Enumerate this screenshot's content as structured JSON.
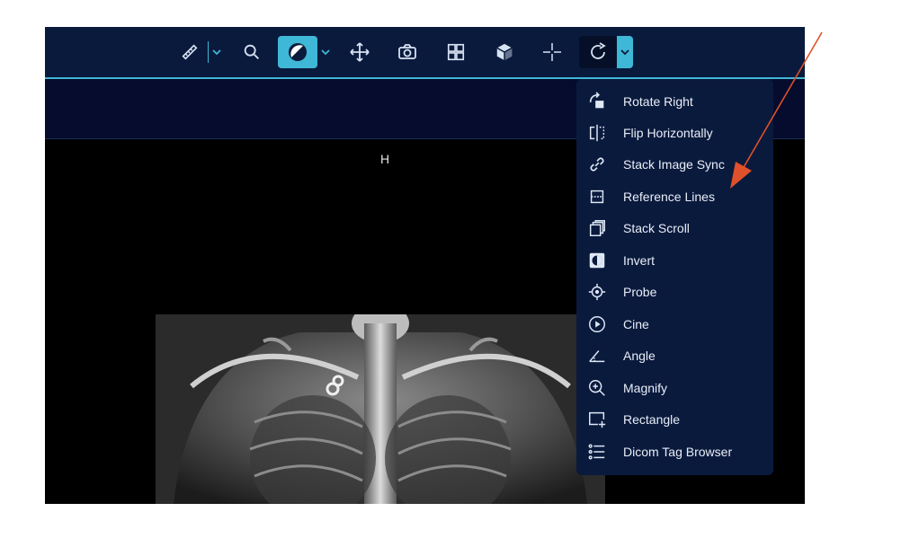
{
  "viewport": {
    "orientation_marker": "H"
  },
  "toolbar": {
    "tools": [
      {
        "id": "measure",
        "icon": "ruler-icon"
      },
      {
        "id": "zoom",
        "icon": "magnifier-icon"
      },
      {
        "id": "window-level",
        "icon": "contrast-icon",
        "active": true
      },
      {
        "id": "pan",
        "icon": "move-arrows-icon"
      },
      {
        "id": "capture",
        "icon": "camera-icon"
      },
      {
        "id": "layout",
        "icon": "grid-layout-icon"
      },
      {
        "id": "3d",
        "icon": "cube-icon"
      },
      {
        "id": "crosshairs",
        "icon": "crosshair-icon"
      },
      {
        "id": "rotate",
        "icon": "rotate-icon",
        "selected": true
      }
    ]
  },
  "menu": {
    "items": [
      {
        "label": "Rotate Right",
        "icon": "rotate-right-icon"
      },
      {
        "label": "Flip Horizontally",
        "icon": "flip-horizontal-icon"
      },
      {
        "label": "Stack Image Sync",
        "icon": "link-icon"
      },
      {
        "label": "Reference Lines",
        "icon": "reference-lines-icon"
      },
      {
        "label": "Stack Scroll",
        "icon": "stack-scroll-icon"
      },
      {
        "label": "Invert",
        "icon": "invert-icon"
      },
      {
        "label": "Probe",
        "icon": "probe-icon"
      },
      {
        "label": "Cine",
        "icon": "cine-play-icon"
      },
      {
        "label": "Angle",
        "icon": "angle-icon"
      },
      {
        "label": "Magnify",
        "icon": "magnify-icon"
      },
      {
        "label": "Rectangle",
        "icon": "rectangle-icon"
      },
      {
        "label": "Dicom Tag Browser",
        "icon": "list-icon"
      }
    ]
  },
  "colors": {
    "toolbar_bg": "#0a1a3d",
    "accent": "#3fb7d6",
    "annotation_arrow": "#e0502a"
  }
}
